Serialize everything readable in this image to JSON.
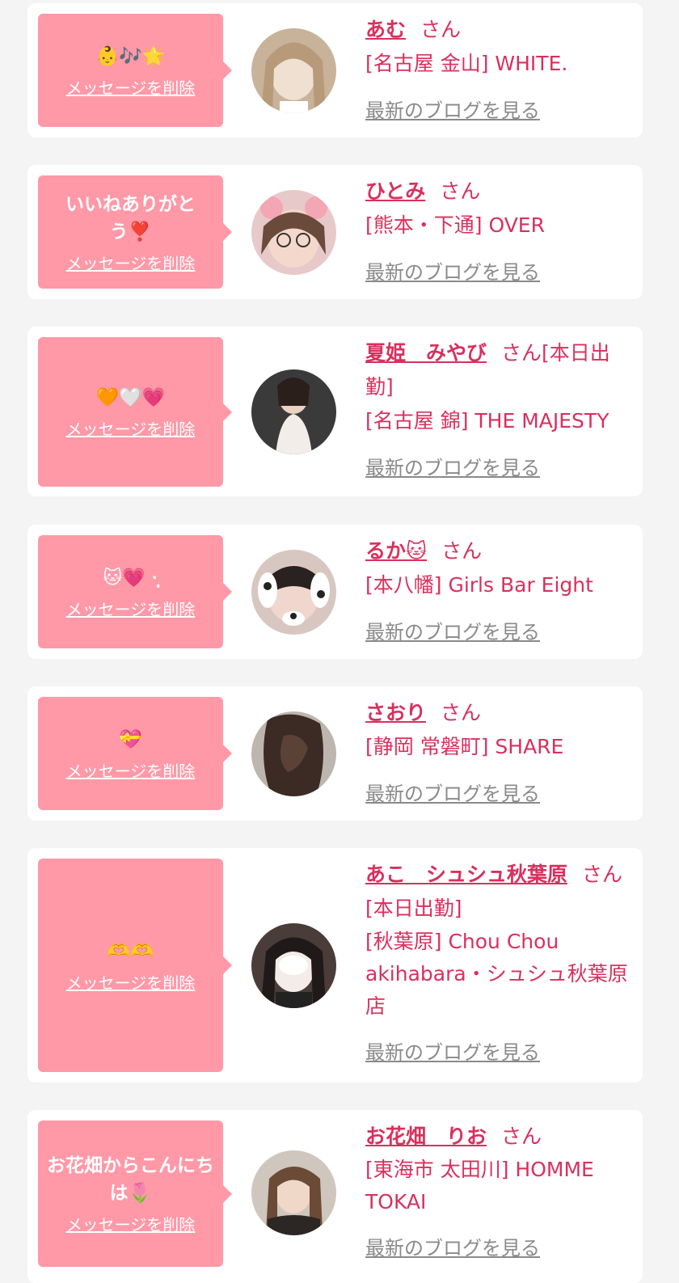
{
  "common": {
    "delete_label": "メッセージを削除",
    "blog_label": "最新のブログを見る",
    "san": "さん"
  },
  "messages": [
    {
      "text": "👶🎶🌟",
      "name": "あむ",
      "after_san": "",
      "shop": "[名古屋 金山] WHITE."
    },
    {
      "text": "いいねありがとう❣️",
      "name": "ひとみ",
      "after_san": "",
      "shop": "[熊本・下通] OVER"
    },
    {
      "text": "🧡🤍💗",
      "name": "夏姫　みやび",
      "after_san": "[本日出勤]",
      "shop": "[名古屋 錦] THE MAJESTY"
    },
    {
      "text": "🐱💗 ·̩͙",
      "name": "るか🐱",
      "after_san": "",
      "shop": "[本八幡] Girls Bar Eight"
    },
    {
      "text": "💝",
      "name": "さおり",
      "after_san": "",
      "shop": "[静岡 常磐町] SHARE"
    },
    {
      "text": "🫶🫶",
      "name": "あこ　シュシュ秋葉原",
      "after_san": "[本日出勤]",
      "shop": "[秋葉原] Chou Chou akihabara・シュシュ秋葉原店"
    },
    {
      "text": "お花畑からこんにちは🌷",
      "name": "お花畑　りお",
      "after_san": "",
      "shop": "[東海市 太田川] HOMME TOKAI"
    }
  ],
  "colors": {
    "accent": "#d9305e",
    "bubble": "#ff98a7",
    "muted": "#8a8a8a",
    "bg": "#f4f4f4"
  }
}
